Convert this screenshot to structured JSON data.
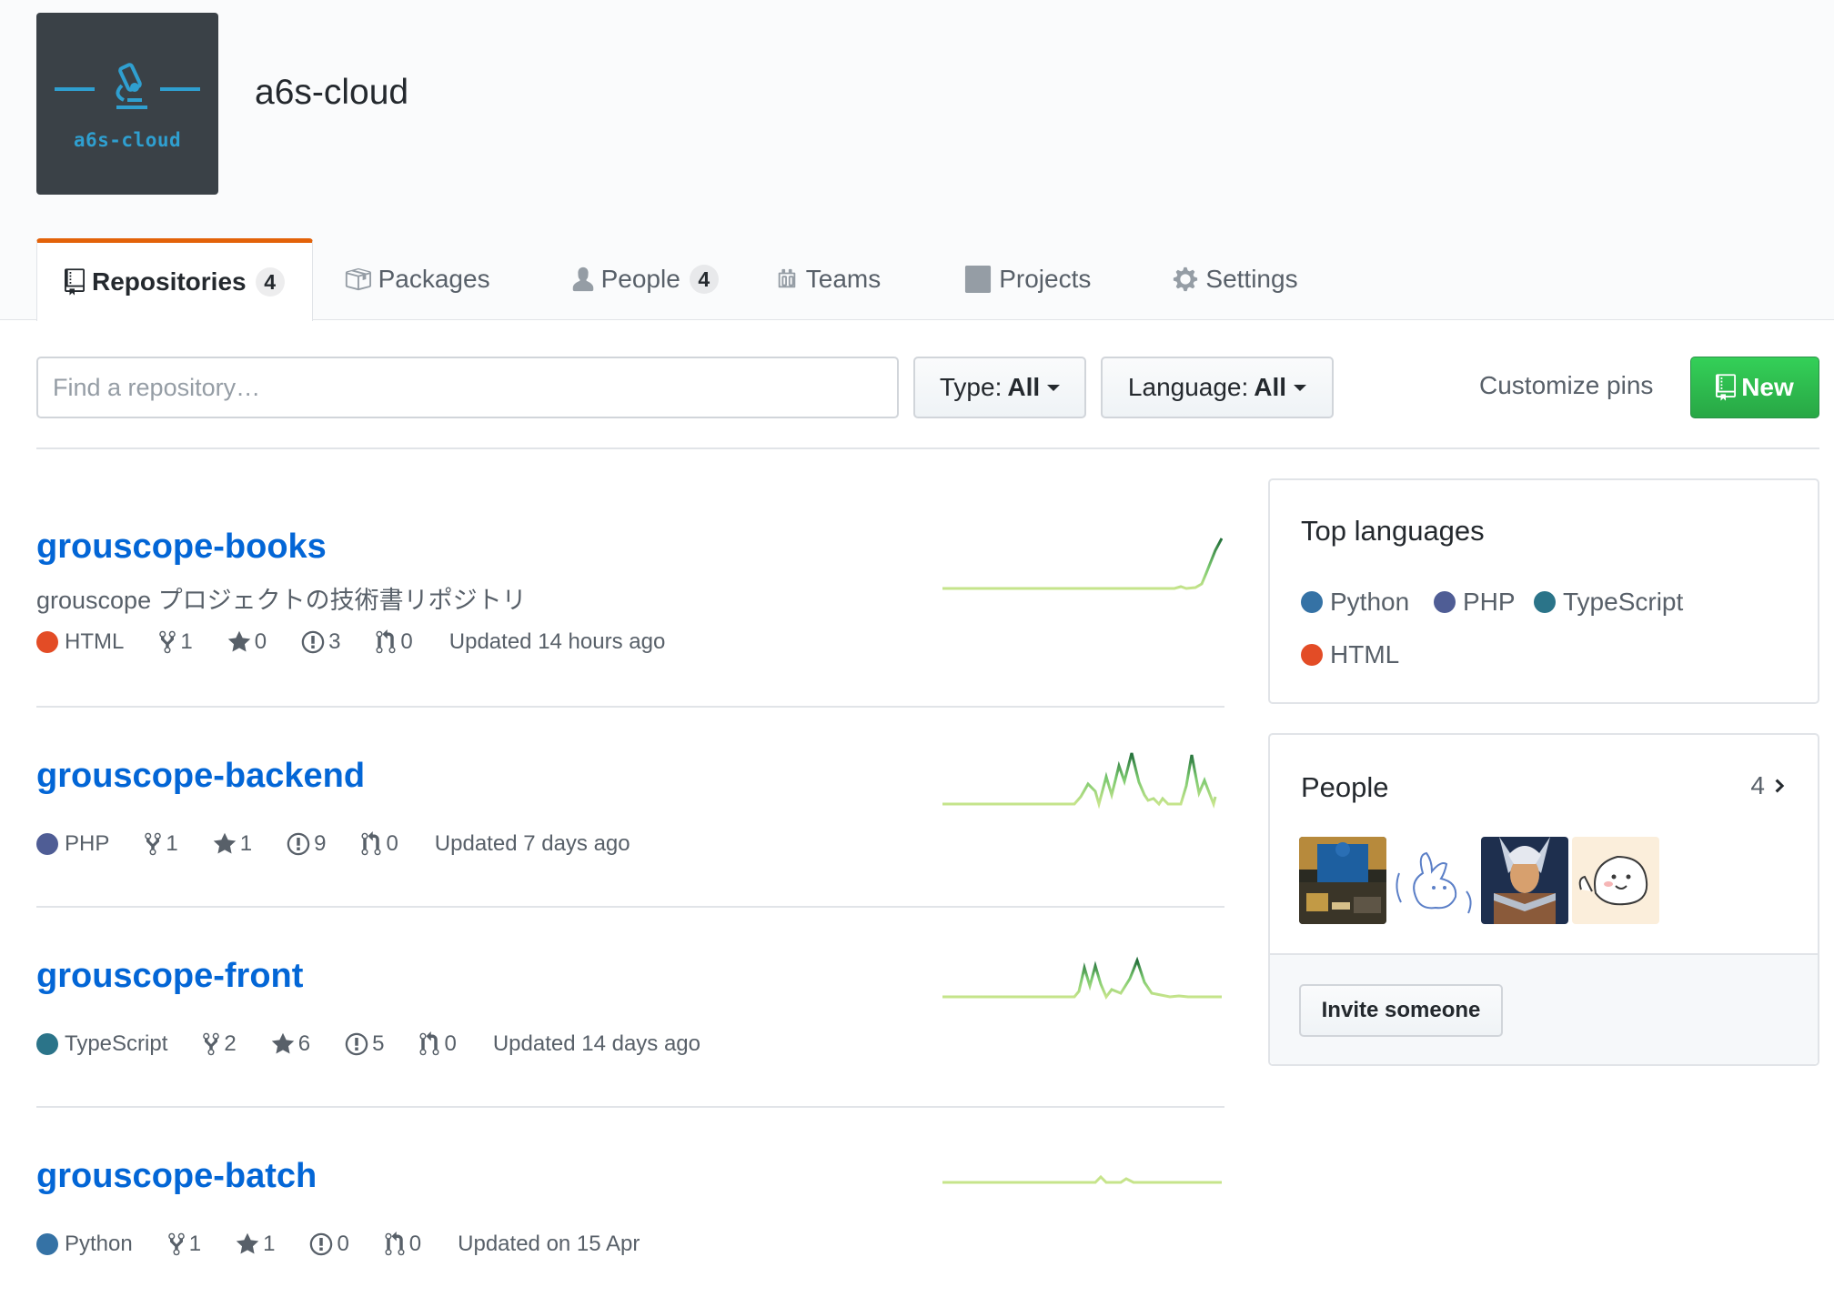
{
  "org": {
    "name": "a6s-cloud",
    "avatar_label": "a6s-cloud"
  },
  "tabs": [
    {
      "label": "Repositories",
      "count": "4",
      "icon": "repo-icon"
    },
    {
      "label": "Packages",
      "icon": "package-icon"
    },
    {
      "label": "People",
      "count": "4",
      "icon": "person-icon"
    },
    {
      "label": "Teams",
      "icon": "jersey-icon"
    },
    {
      "label": "Projects",
      "icon": "project-icon"
    },
    {
      "label": "Settings",
      "icon": "gear-icon"
    }
  ],
  "filters": {
    "search_placeholder": "Find a repository…",
    "type_label": "Type:",
    "type_value": "All",
    "language_label": "Language:",
    "language_value": "All",
    "customize_pins": "Customize pins",
    "new_button": "New"
  },
  "colors": {
    "HTML": "#e34c26",
    "PHP": "#4F5D95",
    "TypeScript": "#2b7489",
    "Python": "#3572A5",
    "tab_accent": "#e36209",
    "link": "#0366d6",
    "new_button": "#28a745"
  },
  "repos": [
    {
      "name": "grouscope-books",
      "description": "grouscope プロジェクトの技術書リポジトリ",
      "language": "HTML",
      "forks": "1",
      "stars": "0",
      "issues": "3",
      "pulls": "0",
      "updated": "Updated 14 hours ago"
    },
    {
      "name": "grouscope-backend",
      "description": "",
      "language": "PHP",
      "forks": "1",
      "stars": "1",
      "issues": "9",
      "pulls": "0",
      "updated": "Updated 7 days ago"
    },
    {
      "name": "grouscope-front",
      "description": "",
      "language": "TypeScript",
      "forks": "2",
      "stars": "6",
      "issues": "5",
      "pulls": "0",
      "updated": "Updated 14 days ago"
    },
    {
      "name": "grouscope-batch",
      "description": "",
      "language": "Python",
      "forks": "1",
      "stars": "1",
      "issues": "0",
      "pulls": "0",
      "updated": "Updated on 15 Apr"
    }
  ],
  "sidebar": {
    "top_languages_title": "Top languages",
    "top_languages": [
      "Python",
      "PHP",
      "TypeScript",
      "HTML"
    ],
    "people_title": "People",
    "people_count": "4",
    "invite_button": "Invite someone"
  }
}
